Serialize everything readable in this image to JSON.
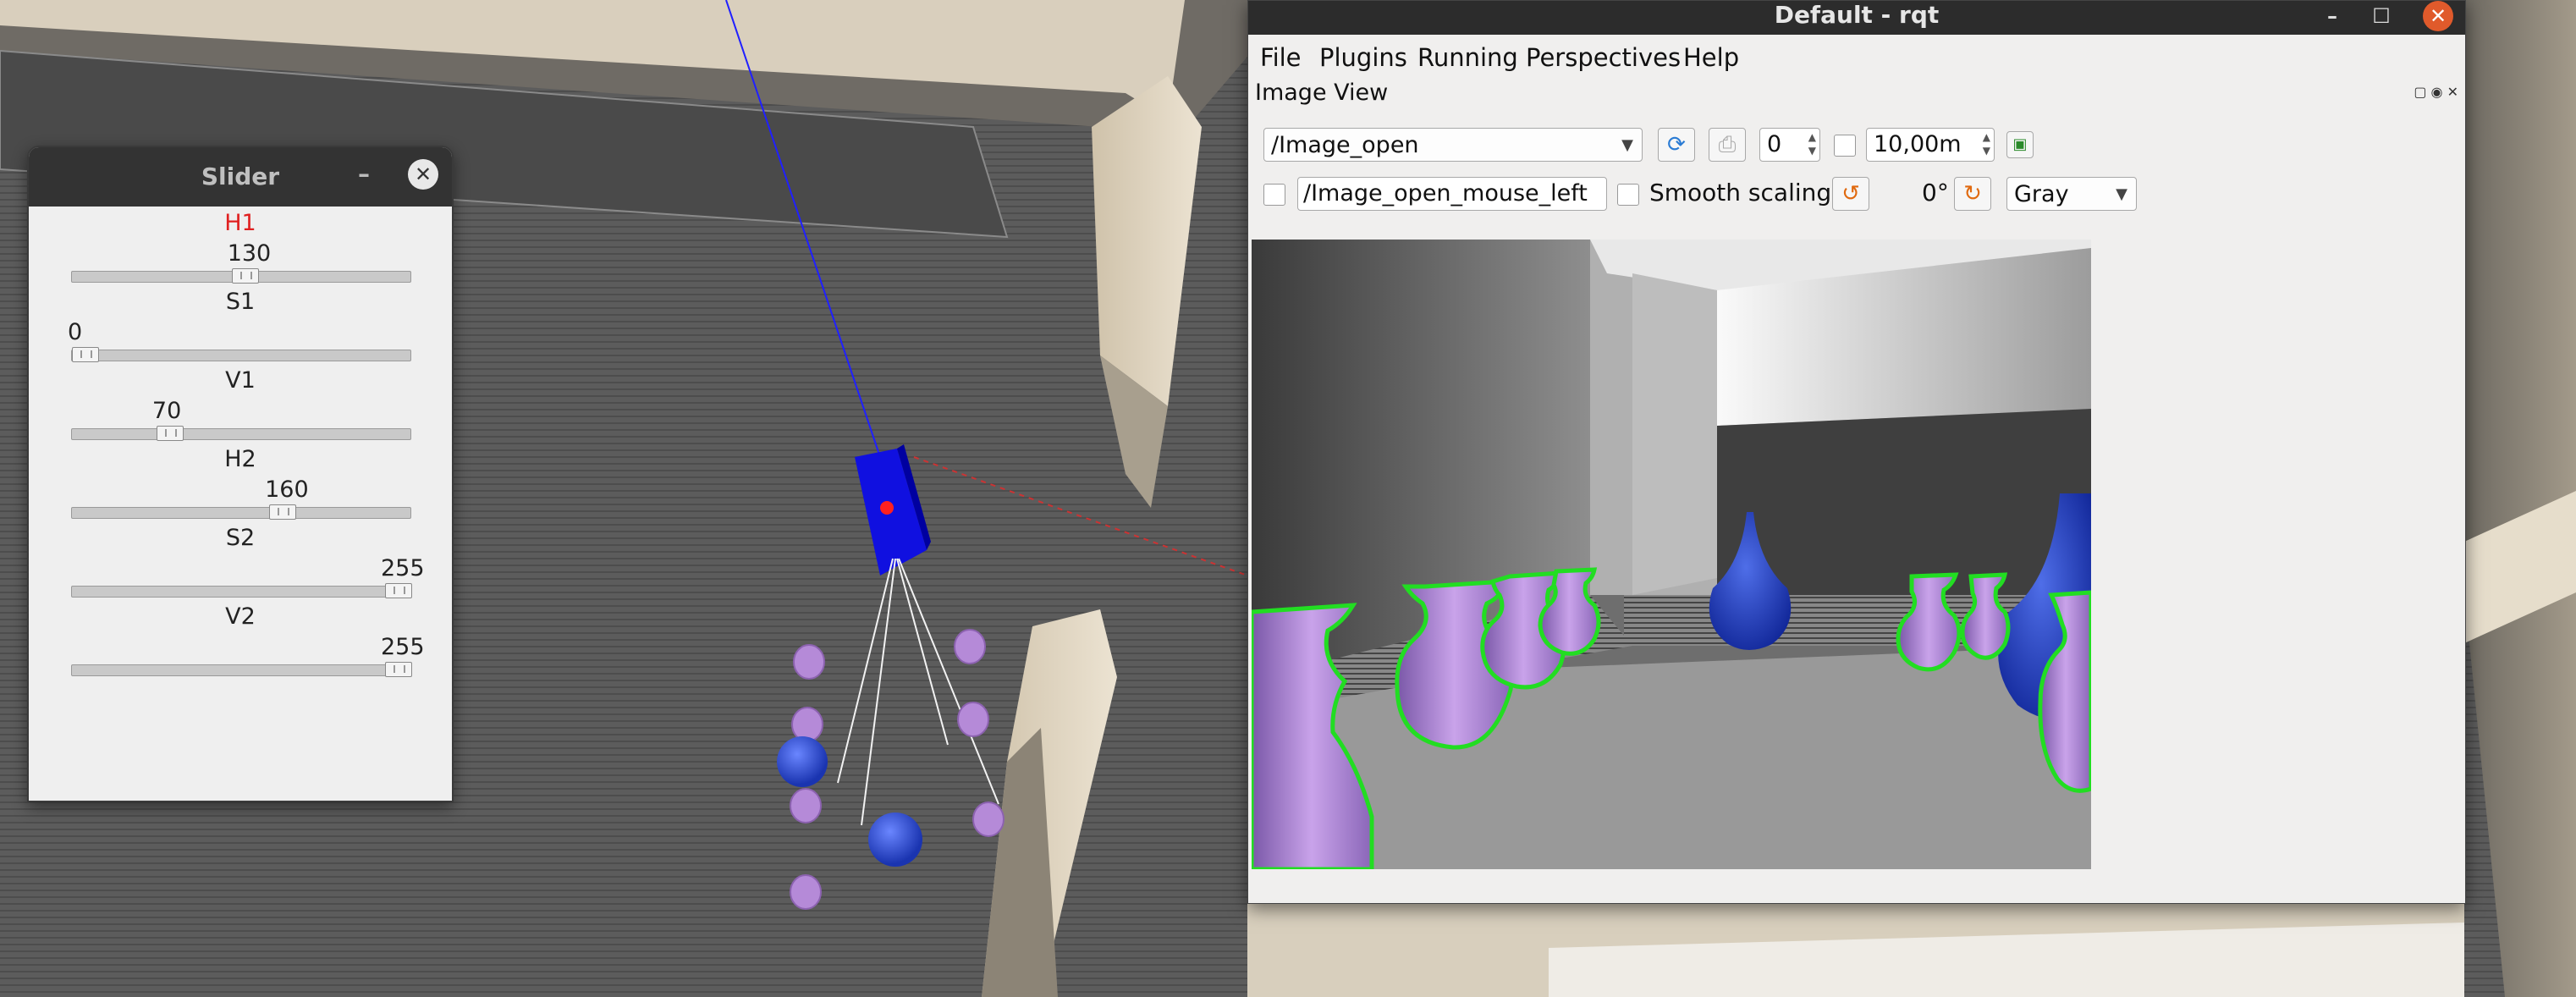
{
  "slider_window": {
    "title": "Slider",
    "sliders": [
      {
        "label": "H1",
        "value": "130",
        "level": 0.51,
        "label_color": "#e02020"
      },
      {
        "label": "S1",
        "value": "0",
        "level": 0.0,
        "label_color": "#222222"
      },
      {
        "label": "V1",
        "value": "70",
        "level": 0.27,
        "label_color": "#222222"
      },
      {
        "label": "H2",
        "value": "160",
        "level": 0.63,
        "label_color": "#222222"
      },
      {
        "label": "S2",
        "value": "255",
        "level": 1.0,
        "label_color": "#222222"
      },
      {
        "label": "V2",
        "value": "255",
        "level": 1.0,
        "label_color": "#222222"
      }
    ]
  },
  "rqt_window": {
    "title": "Default - rqt",
    "menu": [
      "File",
      "Plugins",
      "Running",
      "Perspectives",
      "Help"
    ],
    "dock_title": "Image View",
    "topic_combo": "/Image_open",
    "spin_value": "0",
    "zoom_value": "10,00m",
    "mouse_topic": "/Image_open_mouse_left",
    "smooth_scaling_label": "Smooth scaling",
    "rotation_label": "0°",
    "color_scheme_combo": "Gray"
  },
  "colors": {
    "accent_close": "#e05a2b",
    "highlight_contour": "#22dd22",
    "vase_purple": "#b58ad8",
    "vase_blue": "#2040b0",
    "robot_blue": "#1010e0"
  }
}
